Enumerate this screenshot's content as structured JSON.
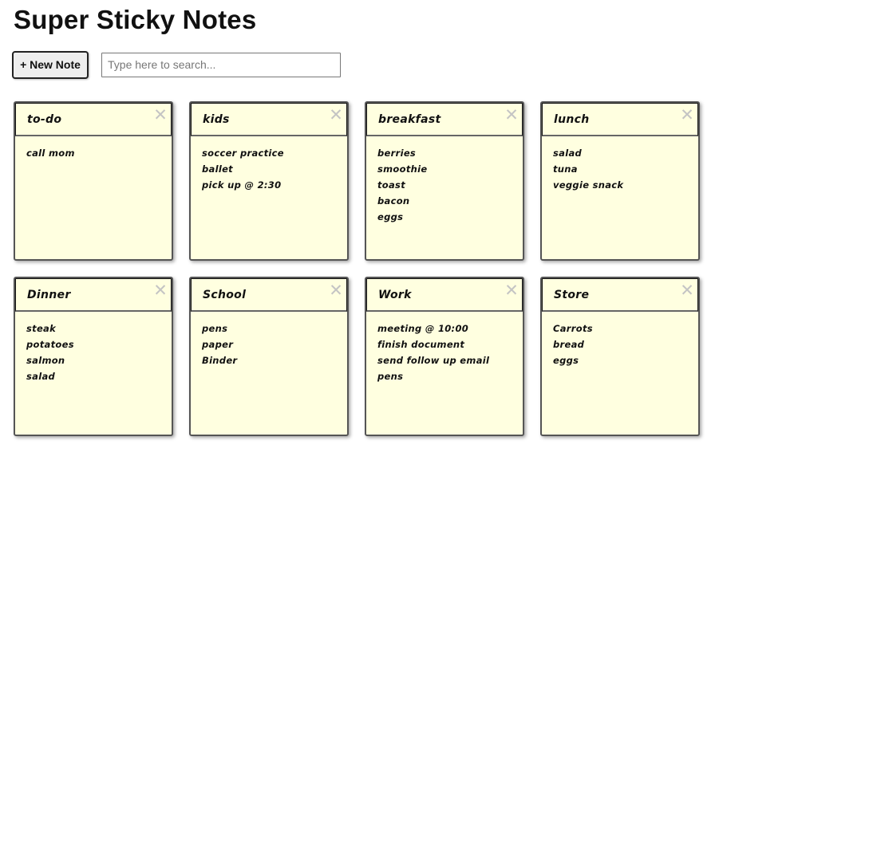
{
  "app": {
    "title": "Super Sticky Notes"
  },
  "toolbar": {
    "new_note_label": "+ New Note",
    "search_placeholder": "Type here to search...",
    "search_value": ""
  },
  "icons": {
    "close": "close-icon"
  },
  "colors": {
    "note_background": "#ffffe0",
    "note_border": "#555555",
    "close_icon": "#c4c4c4"
  },
  "notes": [
    {
      "title": "to-do",
      "lines": [
        "call mom"
      ]
    },
    {
      "title": "kids",
      "lines": [
        "soccer practice",
        "ballet",
        "pick up @ 2:30"
      ]
    },
    {
      "title": "breakfast",
      "lines": [
        "berries",
        "smoothie",
        "toast",
        "bacon",
        "eggs"
      ]
    },
    {
      "title": "lunch",
      "lines": [
        "salad",
        "tuna",
        "veggie snack"
      ]
    },
    {
      "title": "Dinner",
      "lines": [
        "steak",
        "potatoes",
        "salmon",
        "salad"
      ]
    },
    {
      "title": "School",
      "lines": [
        "pens",
        "paper",
        "Binder"
      ]
    },
    {
      "title": "Work",
      "lines": [
        "meeting @ 10:00",
        "finish document",
        "send follow up email",
        "pens"
      ]
    },
    {
      "title": "Store",
      "lines": [
        "Carrots",
        "bread",
        "eggs"
      ]
    }
  ]
}
